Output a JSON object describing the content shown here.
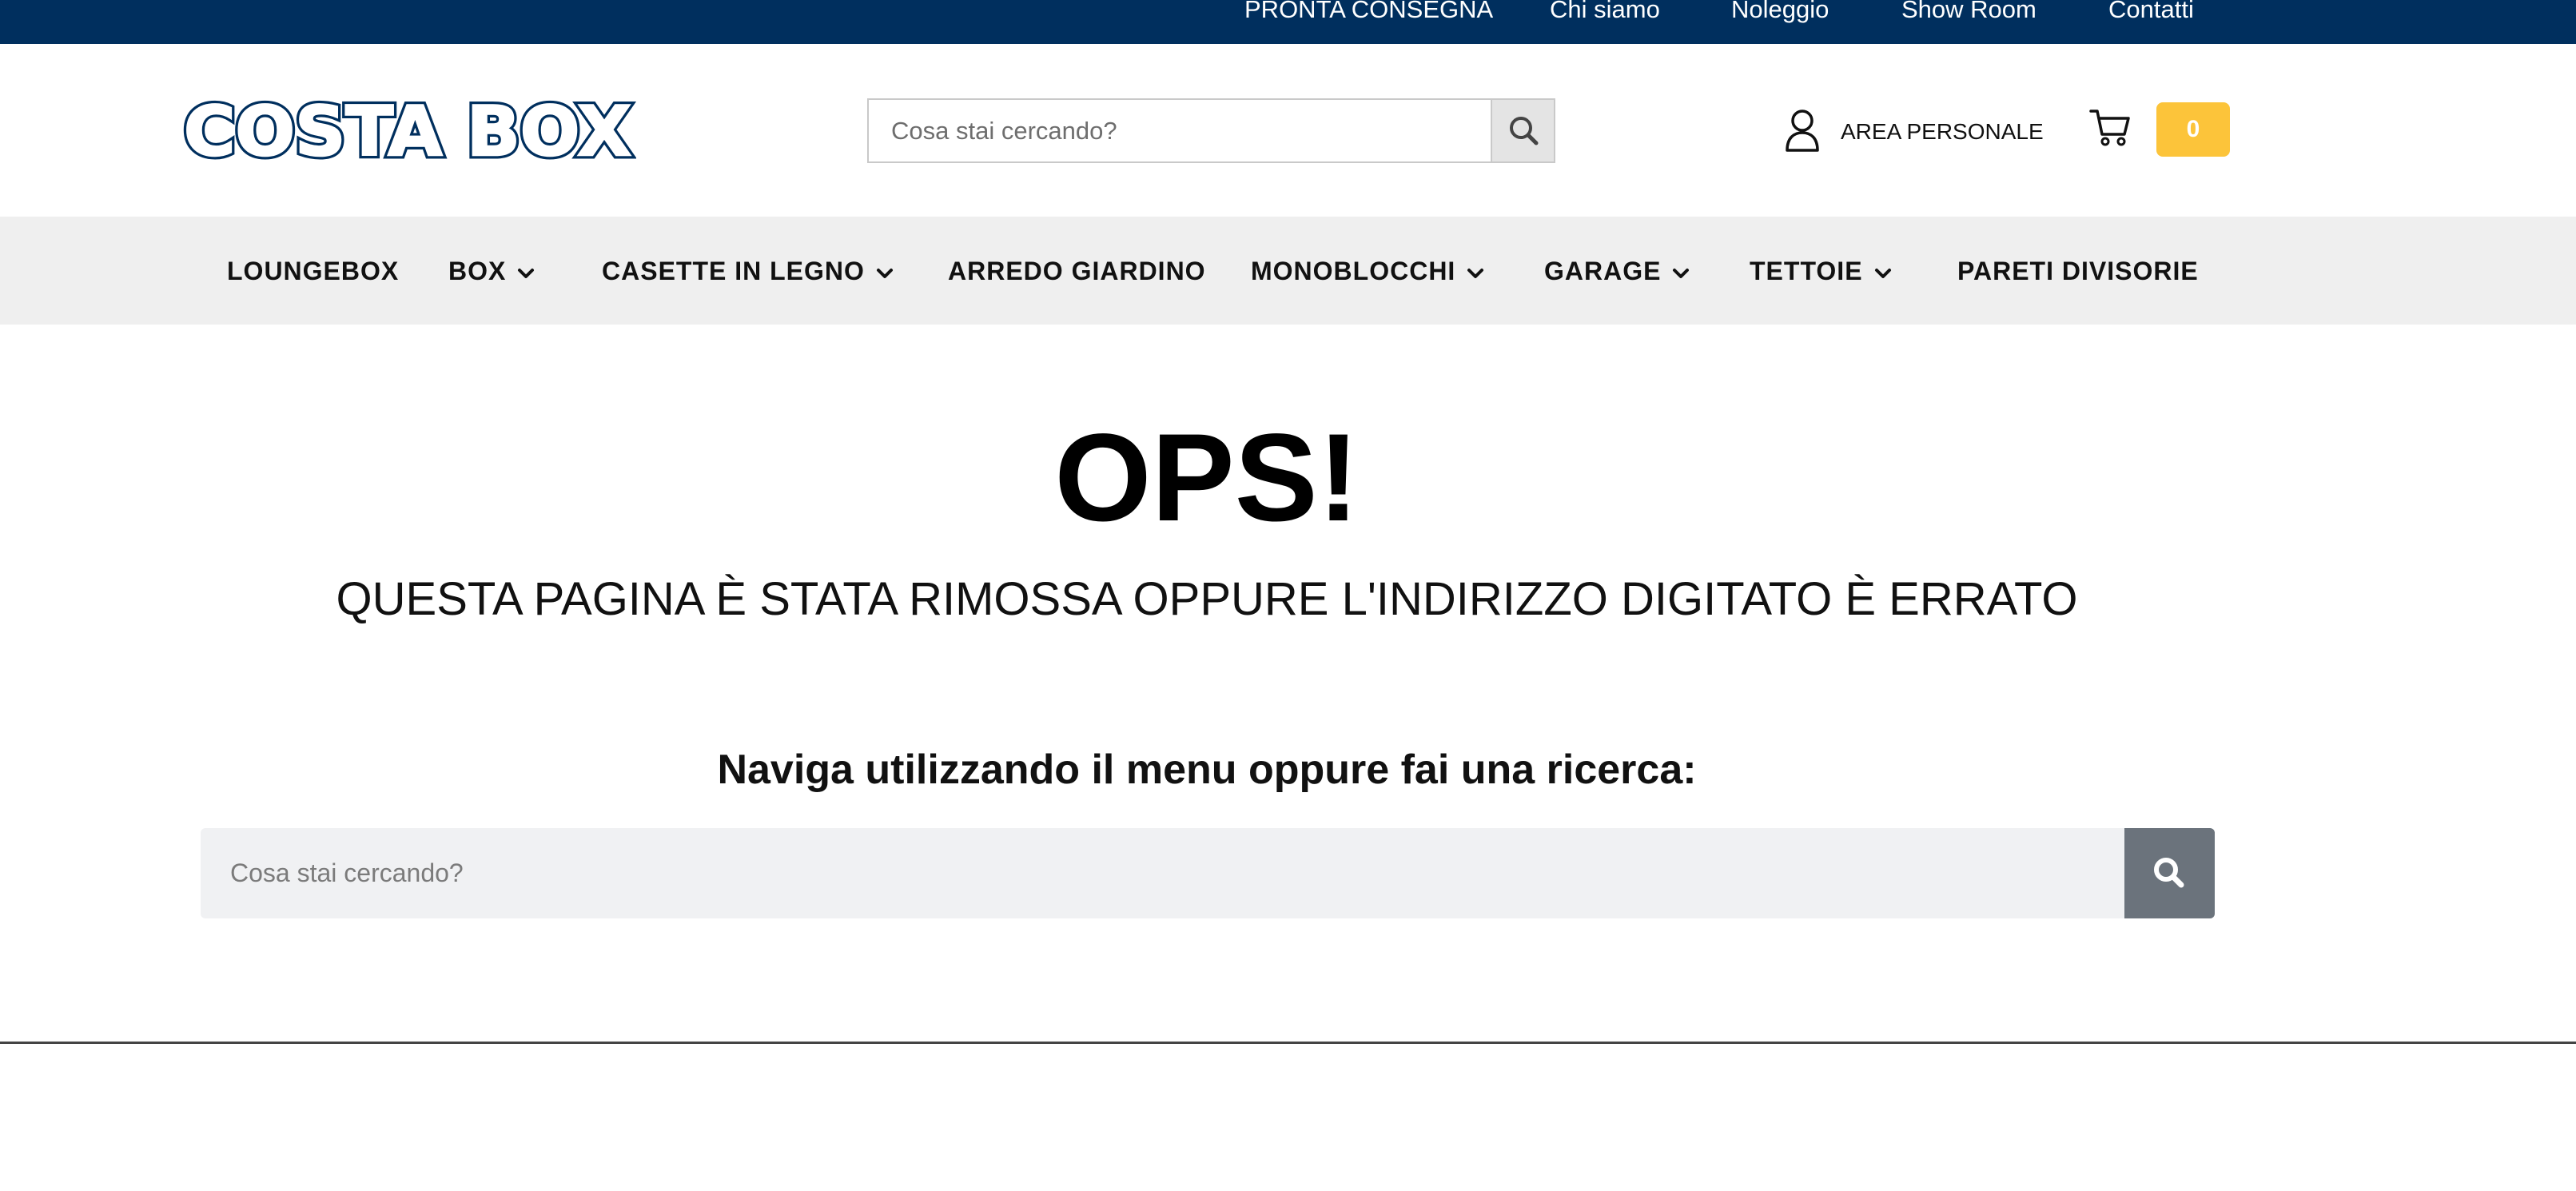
{
  "brand": {
    "logo_text": "COSTA BOX",
    "primary_color": "#002f5e",
    "accent_color": "#fcc43a"
  },
  "topbar": {
    "links": [
      {
        "label": "PRONTA CONSEGNA"
      },
      {
        "label": "Chi siamo"
      },
      {
        "label": "Noleggio"
      },
      {
        "label": "Show Room"
      },
      {
        "label": "Contatti"
      }
    ]
  },
  "header": {
    "search": {
      "placeholder": "Cosa stai cercando?",
      "value": "",
      "icon": "search-icon"
    },
    "account": {
      "label": "AREA PERSONALE",
      "icon": "user-icon"
    },
    "cart": {
      "icon": "cart-icon",
      "count": "0"
    }
  },
  "nav": {
    "items": [
      {
        "label": "LOUNGEBOX",
        "has_dropdown": false
      },
      {
        "label": "BOX",
        "has_dropdown": true
      },
      {
        "label": "CASETTE IN LEGNO",
        "has_dropdown": true
      },
      {
        "label": "ARREDO GIARDINO",
        "has_dropdown": false
      },
      {
        "label": "MONOBLOCCHI",
        "has_dropdown": true
      },
      {
        "label": "GARAGE",
        "has_dropdown": true
      },
      {
        "label": "TETTOIE",
        "has_dropdown": true
      },
      {
        "label": "PARETI DIVISORIE",
        "has_dropdown": false
      }
    ]
  },
  "error_page": {
    "title": "OPS!",
    "subtitle": "QUESTA PAGINA È STATA RIMOSSA OPPURE L'INDIRIZZO DIGITATO È ERRATO",
    "hint": "Naviga utilizzando il menu oppure fai una ricerca:",
    "search": {
      "placeholder": "Cosa stai cercando?",
      "value": "",
      "icon": "search-icon"
    }
  }
}
